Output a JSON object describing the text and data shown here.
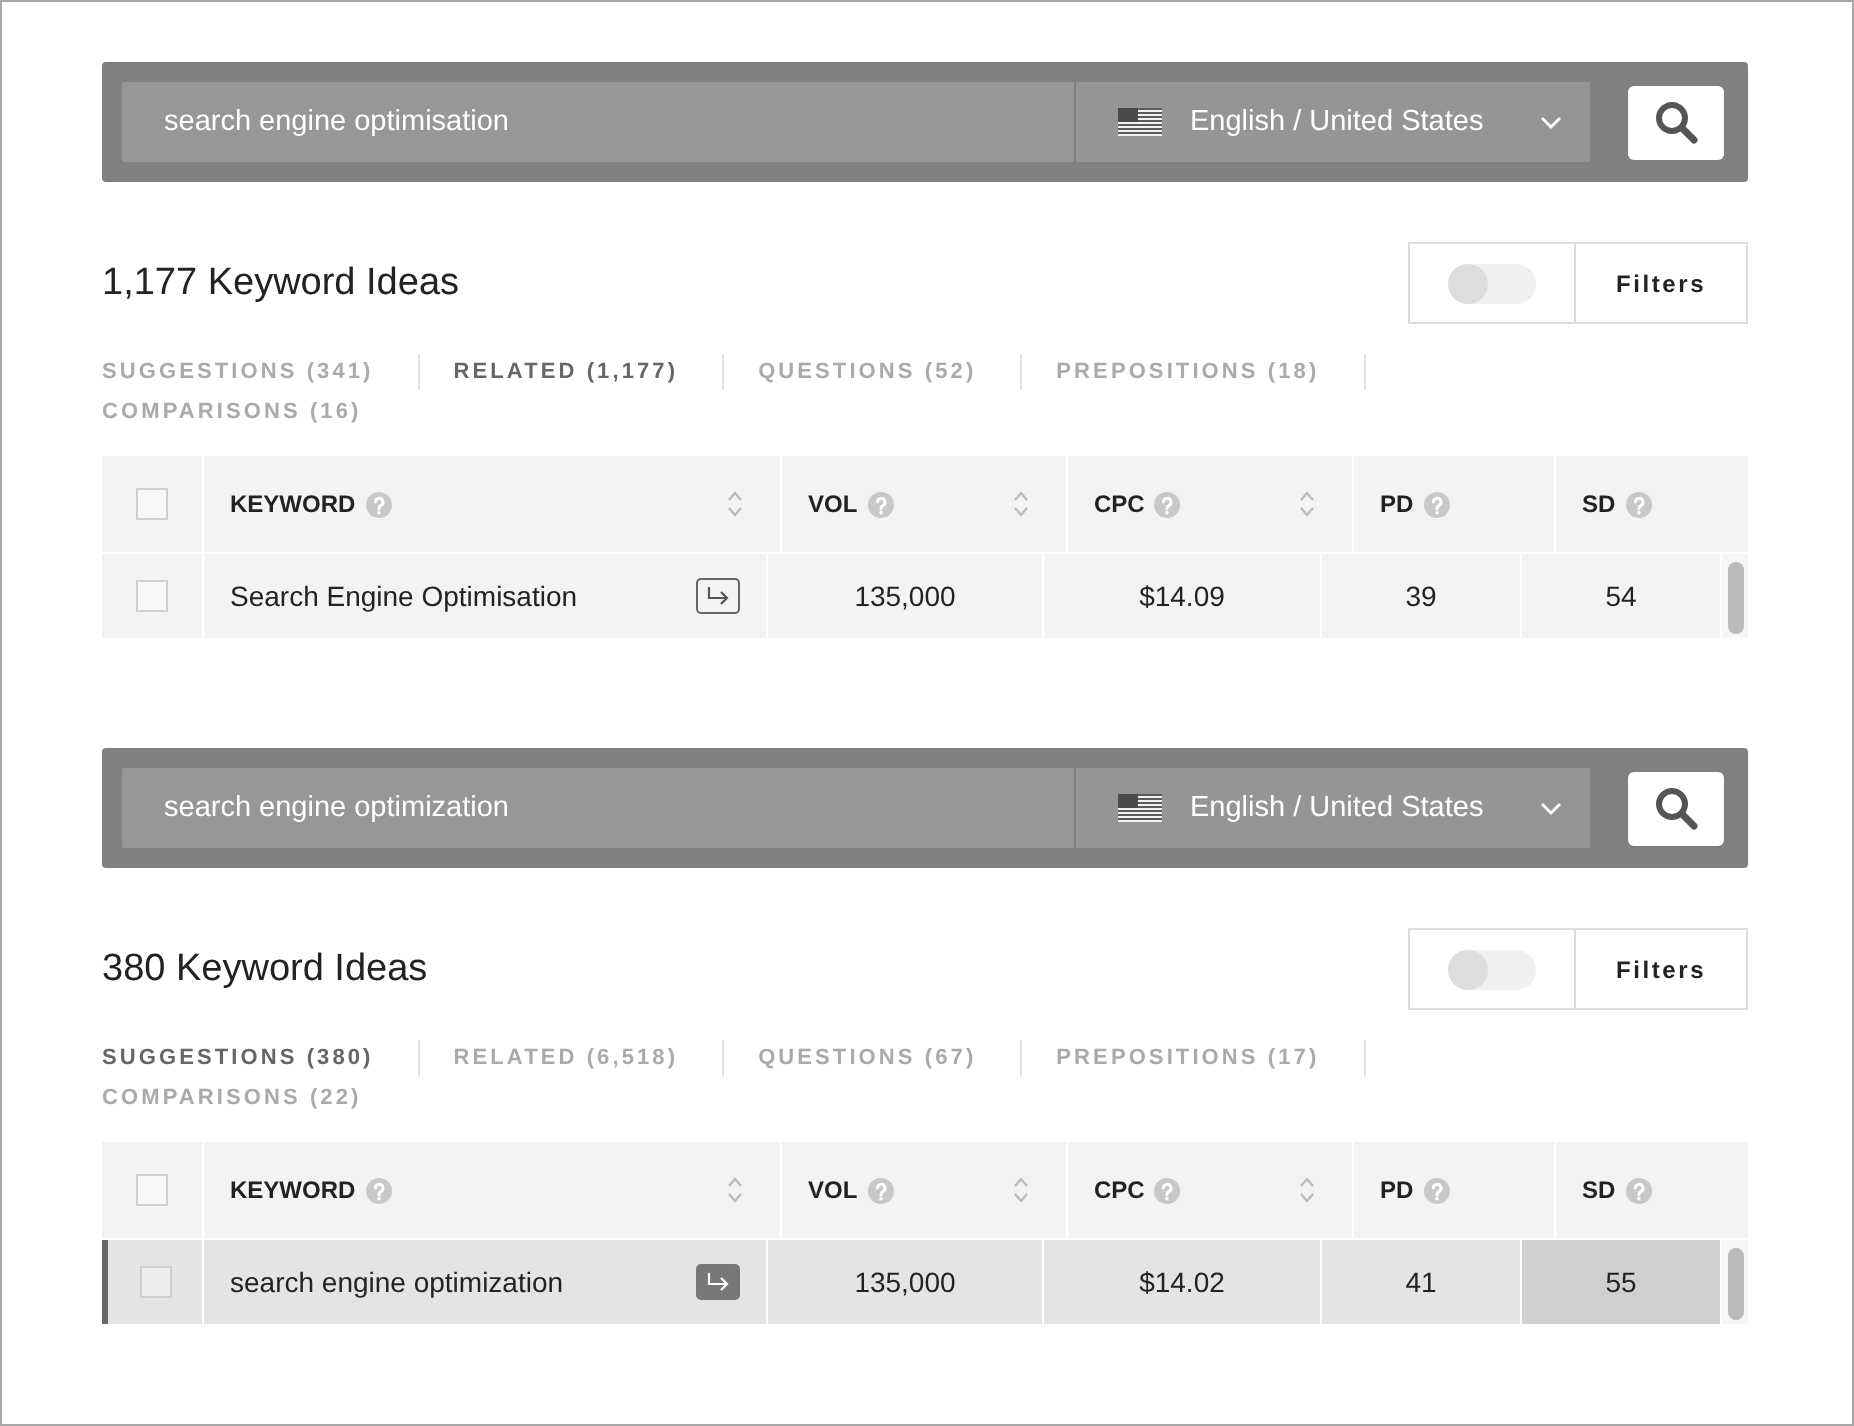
{
  "panels": [
    {
      "search": {
        "query": "search engine optimisation",
        "language": "English / United States"
      },
      "title": "1,177 Keyword Ideas",
      "filters": {
        "label": "Filters",
        "on": false
      },
      "tabs": [
        {
          "label": "SUGGESTIONS (341)",
          "selected": false
        },
        {
          "label": "RELATED (1,177)",
          "selected": true
        },
        {
          "label": "QUESTIONS (52)",
          "selected": false
        },
        {
          "label": "PREPOSITIONS (18)",
          "selected": false
        },
        {
          "label": "COMPARISONS (16)",
          "selected": false
        }
      ],
      "table": {
        "all_checked": false,
        "columns": [
          {
            "label": "KEYWORD",
            "sortable": true
          },
          {
            "label": "VOL",
            "sortable": true
          },
          {
            "label": "CPC",
            "sortable": true
          },
          {
            "label": "PD",
            "sortable": false
          },
          {
            "label": "SD",
            "sortable": false
          }
        ],
        "rows": [
          {
            "selected": false,
            "checked": false,
            "keyword": "Search Engine Optimisation",
            "cells": [
              {
                "text": "135,000",
                "highlighted": false
              },
              {
                "text": "$14.09",
                "highlighted": false
              },
              {
                "text": "39",
                "highlighted": false
              },
              {
                "text": "54",
                "highlighted": false
              }
            ]
          }
        ]
      }
    },
    {
      "search": {
        "query": "search engine optimization",
        "language": "English / United States"
      },
      "title": "380 Keyword Ideas",
      "filters": {
        "label": "Filters",
        "on": false
      },
      "tabs": [
        {
          "label": "SUGGESTIONS (380)",
          "selected": true
        },
        {
          "label": "RELATED (6,518)",
          "selected": false
        },
        {
          "label": "QUESTIONS (67)",
          "selected": false
        },
        {
          "label": "PREPOSITIONS (17)",
          "selected": false
        },
        {
          "label": "COMPARISONS (22)",
          "selected": false
        }
      ],
      "table": {
        "all_checked": false,
        "columns": [
          {
            "label": "KEYWORD",
            "sortable": true
          },
          {
            "label": "VOL",
            "sortable": true
          },
          {
            "label": "CPC",
            "sortable": true
          },
          {
            "label": "PD",
            "sortable": false
          },
          {
            "label": "SD",
            "sortable": false
          }
        ],
        "rows": [
          {
            "selected": true,
            "checked": false,
            "keyword": "search engine optimization",
            "cells": [
              {
                "text": "135,000",
                "highlighted": false
              },
              {
                "text": "$14.02",
                "highlighted": false
              },
              {
                "text": "41",
                "highlighted": false
              },
              {
                "text": "55",
                "highlighted": true
              }
            ]
          }
        ]
      }
    }
  ]
}
